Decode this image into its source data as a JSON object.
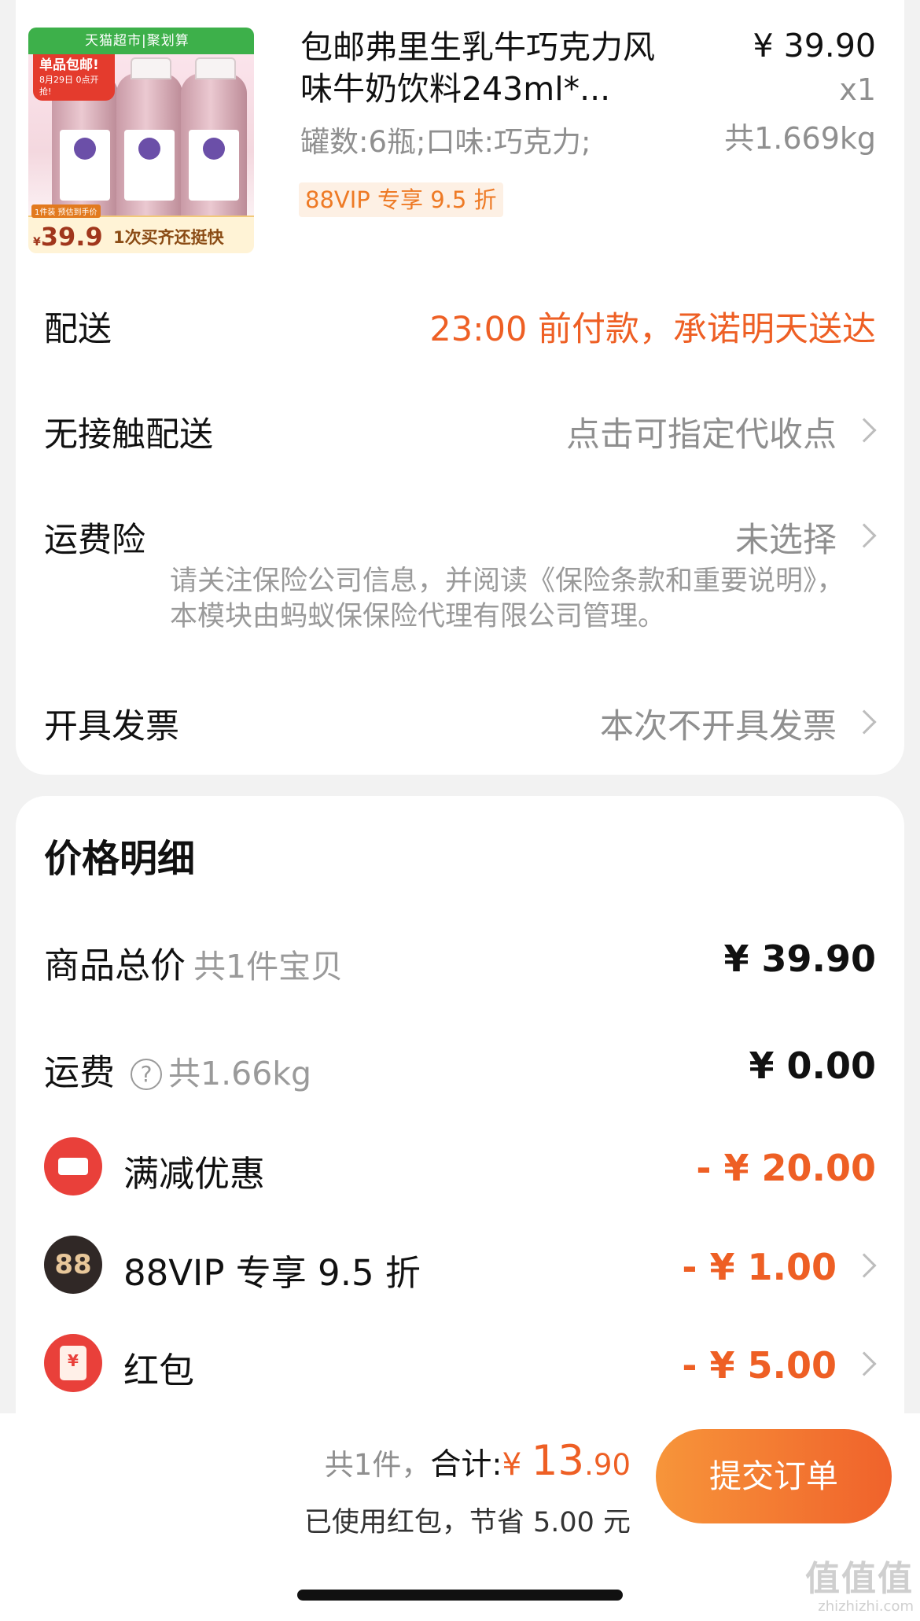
{
  "product": {
    "thumb_header": "天猫超市|聚划算",
    "thumb_badge_main": "单品包邮!",
    "thumb_badge_sub": "8月29日 0点开抢!",
    "thumb_note": "1件装 预估到手价",
    "thumb_price_symbol": "¥",
    "thumb_price": "39.9",
    "thumb_slogan": "1次买齐还挺快",
    "title": "包邮弗里生乳牛巧克力风味牛奶饮料243ml*...",
    "spec": "罐数:6瓶;口味:巧克力;",
    "vip_tag": "88VIP 专享 9.5 折",
    "price": "¥ 39.90",
    "quantity": "x1",
    "weight": "共1.669kg"
  },
  "delivery": {
    "label": "配送",
    "value": "23:00 前付款，承诺明天送达"
  },
  "contactless": {
    "label": "无接触配送",
    "value": "点击可指定代收点"
  },
  "shipping_insurance": {
    "label": "运费险",
    "value": "未选择",
    "note": "请关注保险公司信息，并阅读《保险条款和重要说明》，本模块由蚂蚁保保险代理有限公司管理。"
  },
  "invoice": {
    "label": "开具发票",
    "value": "本次不开具发票"
  },
  "price_detail": {
    "title": "价格明细",
    "goods_total_label": "商品总价",
    "goods_total_sub": "共1件宝贝",
    "goods_total_value": "¥ 39.90",
    "freight_label": "运费",
    "freight_help": "?",
    "freight_sub": "共1.66kg",
    "freight_value": "¥ 0.00",
    "discounts": [
      {
        "label": "满减优惠",
        "value": "- ¥ 20.00",
        "icon": "coupon-icon"
      },
      {
        "label": "88VIP 专享 9.5 折",
        "value": "- ¥ 1.00",
        "icon": "vip88-icon",
        "icon_text": "88"
      },
      {
        "label": "红包",
        "value": "- ¥ 5.00",
        "icon": "red-packet-icon",
        "icon_text": "¥"
      }
    ]
  },
  "footer": {
    "count": "共1件，",
    "total_label": "合计:",
    "total_symbol": "¥ ",
    "total_int": "13",
    "total_dec": ".90",
    "saving_note": "已使用红包，节省 5.00 元",
    "submit_label": "提交订单"
  },
  "watermark": {
    "main": "值值值",
    "url": "zhizhizhi.com"
  },
  "colors": {
    "accent": "#ee5f24",
    "button_start": "#f7953a",
    "button_end": "#f0622b",
    "background": "#f2f2f2"
  }
}
